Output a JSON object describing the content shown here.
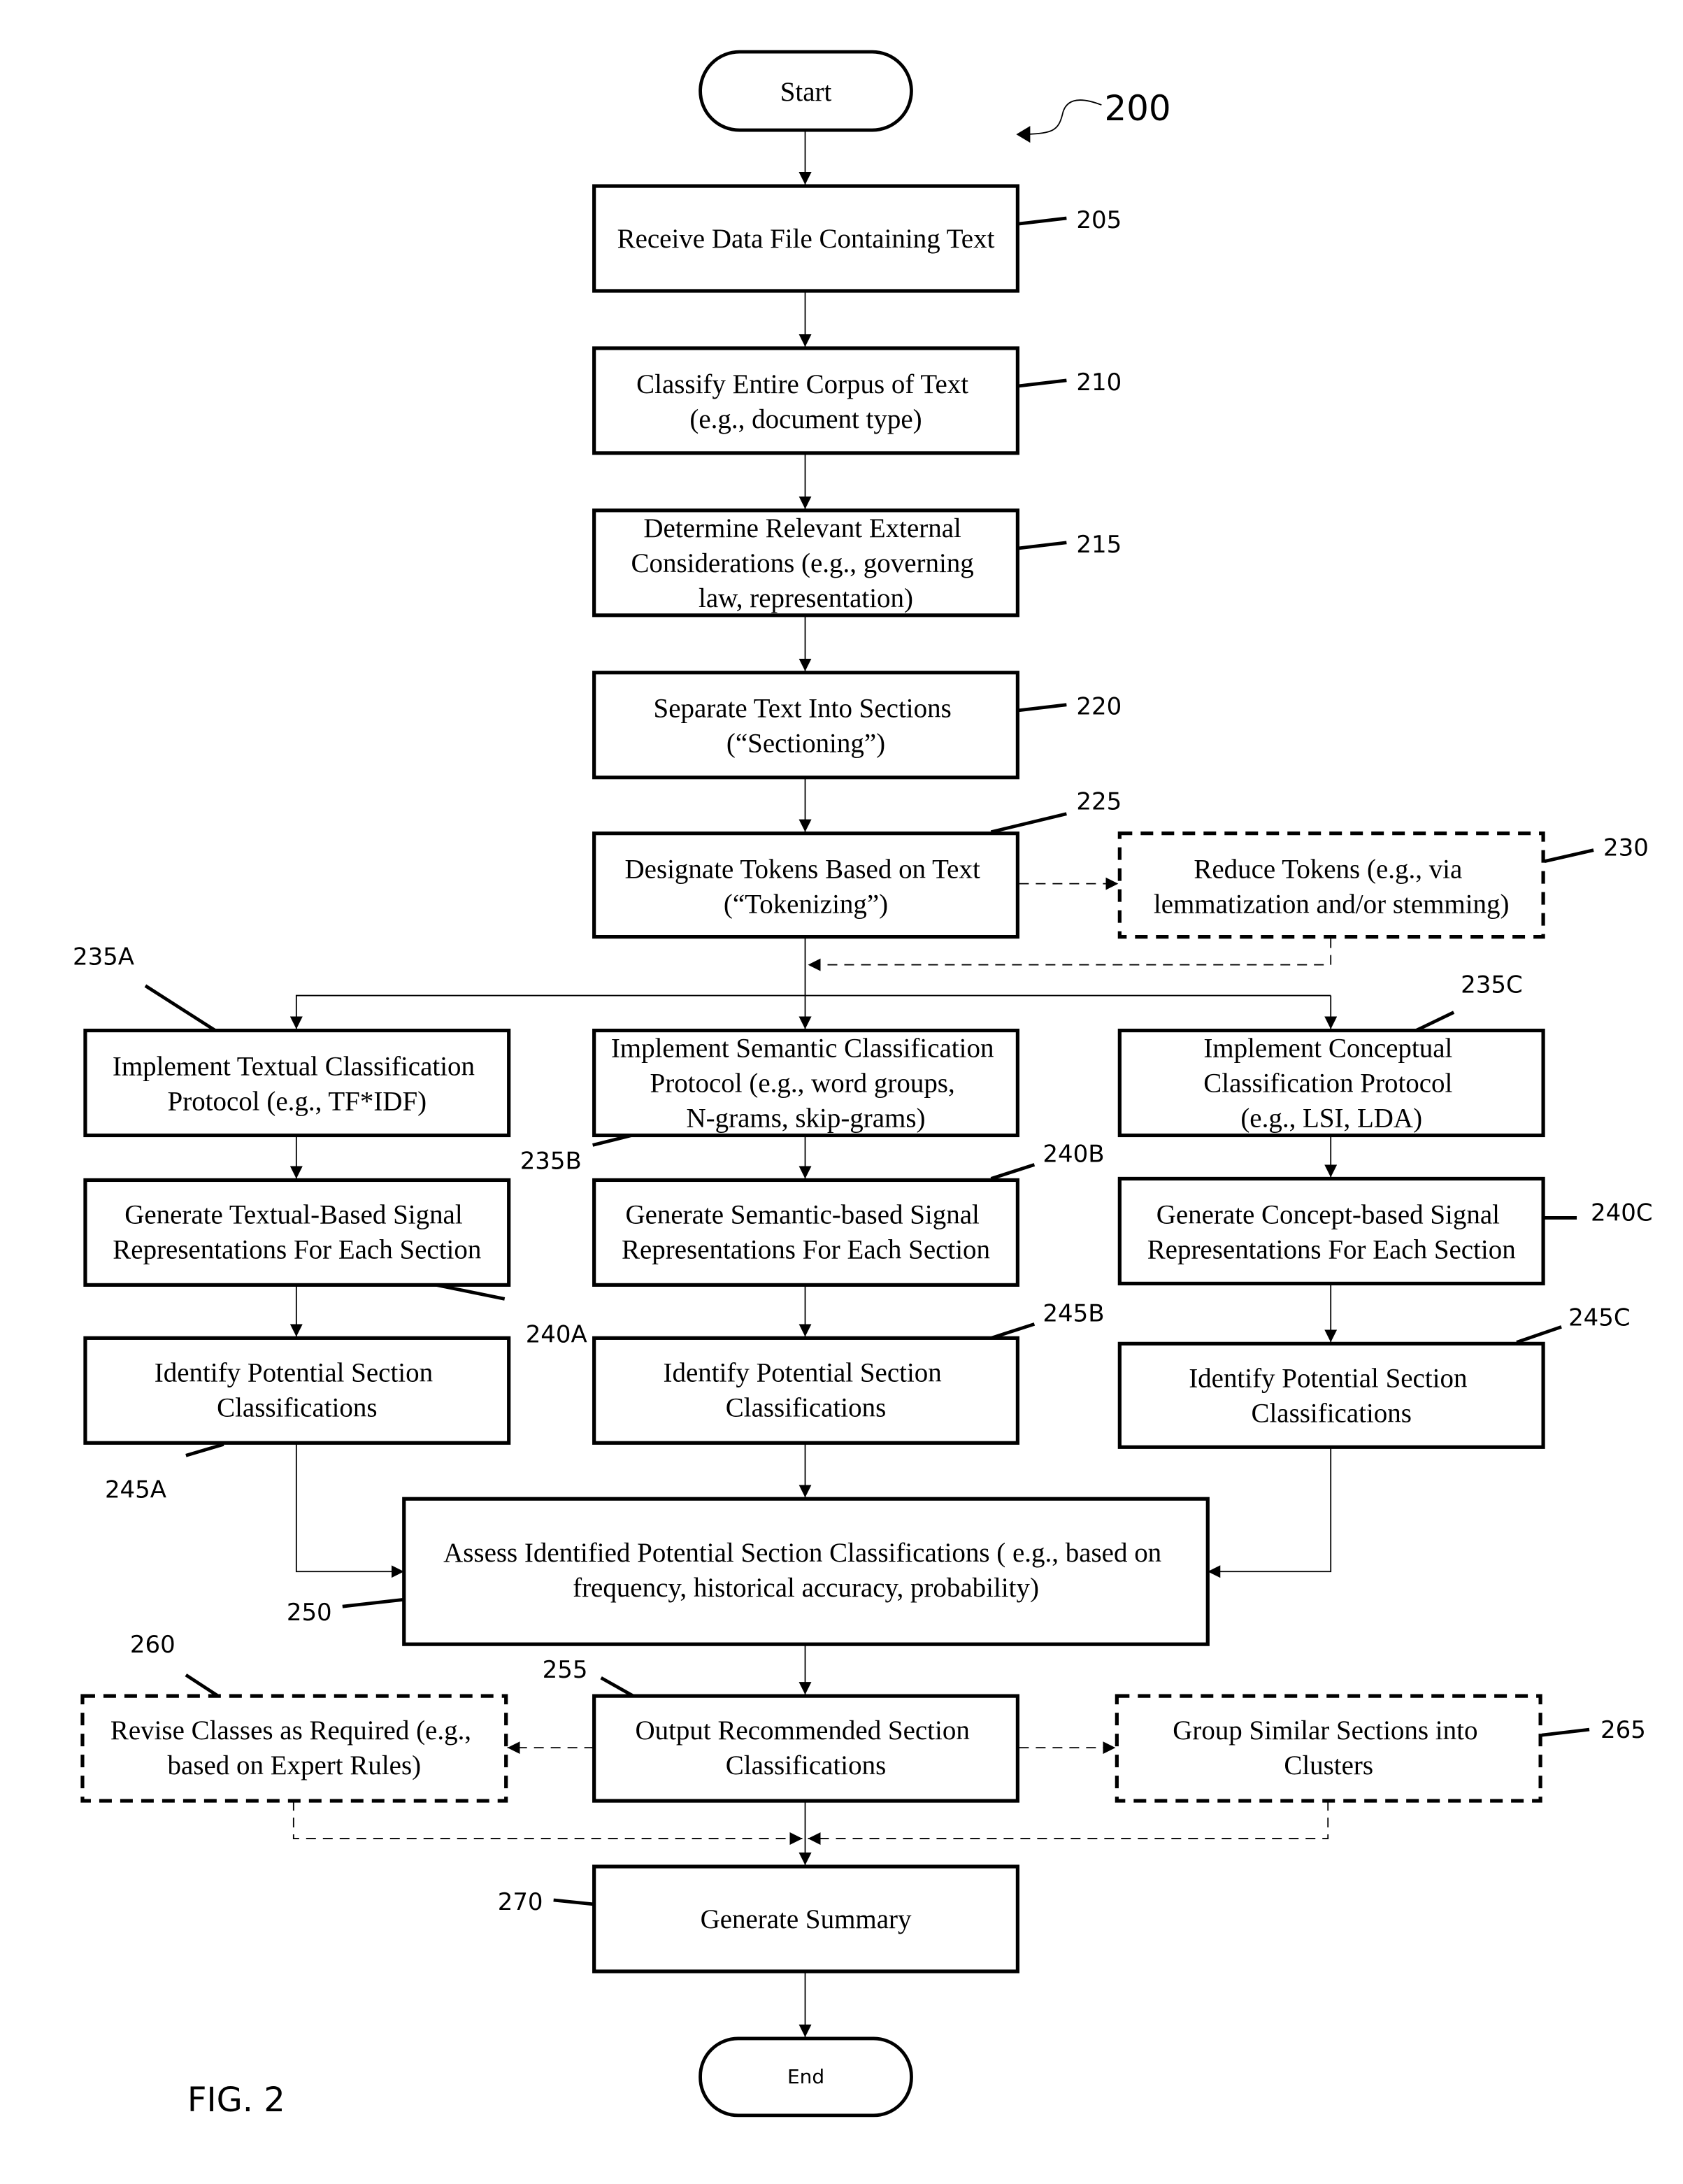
{
  "figure": {
    "label": "FIG. 2",
    "reference": "200"
  },
  "terminals": {
    "start": "Start",
    "end": "End"
  },
  "steps": {
    "s205": {
      "ref": "205",
      "lines": [
        "Receive Data File Containing Text"
      ]
    },
    "s210": {
      "ref": "210",
      "lines": [
        "Classify Entire Corpus of Text",
        "(e.g., document type)"
      ]
    },
    "s215": {
      "ref": "215",
      "lines": [
        "Determine Relevant External",
        "Considerations (e.g., governing",
        "law, representation)"
      ]
    },
    "s220": {
      "ref": "220",
      "lines": [
        "Separate Text Into Sections",
        "(“Sectioning”)"
      ]
    },
    "s225": {
      "ref": "225",
      "lines": [
        "Designate Tokens Based on Text",
        "(“Tokenizing”)"
      ]
    },
    "s230": {
      "ref": "230",
      "optional": true,
      "lines": [
        "Reduce Tokens (e.g., via",
        "lemmatization and/or stemming)"
      ]
    },
    "s235A": {
      "ref": "235A",
      "lines": [
        "Implement Textual Classification",
        "Protocol (e.g., TF*IDF)"
      ]
    },
    "s235B": {
      "ref": "235B",
      "lines": [
        "Implement Semantic Classification",
        "Protocol (e.g., word groups,",
        "N-grams, skip-grams)"
      ]
    },
    "s235C": {
      "ref": "235C",
      "lines": [
        "Implement Conceptual",
        "Classification Protocol",
        "(e.g.,  LSI, LDA)"
      ]
    },
    "s240A": {
      "ref": "240A",
      "lines": [
        "Generate Textual-Based Signal",
        "Representations For Each Section"
      ]
    },
    "s240B": {
      "ref": "240B",
      "lines": [
        "Generate Semantic-based Signal",
        "Representations For Each Section"
      ]
    },
    "s240C": {
      "ref": "240C",
      "lines": [
        "Generate Concept-based Signal",
        "Representations For Each Section"
      ]
    },
    "s245A": {
      "ref": "245A",
      "lines": [
        "Identify Potential Section",
        "Classifications"
      ]
    },
    "s245B": {
      "ref": "245B",
      "lines": [
        "Identify Potential Section",
        "Classifications"
      ]
    },
    "s245C": {
      "ref": "245C",
      "lines": [
        "Identify Potential Section",
        "Classifications"
      ]
    },
    "s250": {
      "ref": "250",
      "lines": [
        "Assess Identified Potential Section Classifications ( e.g., based on",
        "frequency, historical accuracy, probability)"
      ]
    },
    "s255": {
      "ref": "255",
      "lines": [
        "Output Recommended Section",
        "Classifications"
      ]
    },
    "s260": {
      "ref": "260",
      "optional": true,
      "lines": [
        "Revise Classes as Required (e.g.,",
        "based on Expert Rules)"
      ]
    },
    "s265": {
      "ref": "265",
      "optional": true,
      "lines": [
        "Group Similar Sections into",
        "Clusters"
      ]
    },
    "s270": {
      "ref": "270",
      "lines": [
        "Generate Summary"
      ]
    }
  }
}
